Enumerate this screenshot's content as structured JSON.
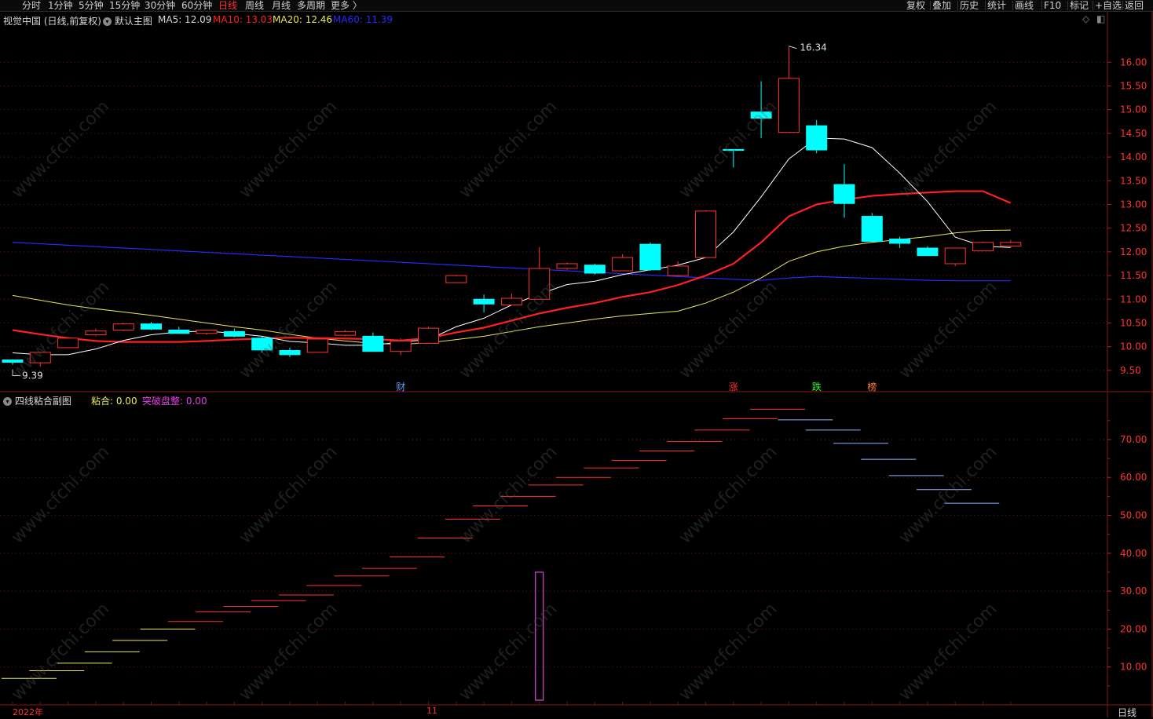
{
  "periods": [
    "分时",
    "1分钟",
    "5分钟",
    "15分钟",
    "30分钟",
    "60分钟",
    "日线",
    "周线",
    "月线",
    "多周期",
    "更多 〉"
  ],
  "active_period": "日线",
  "right_tools": [
    "复权",
    "叠加",
    "历史",
    "统计",
    "画线",
    "F10",
    "标记",
    "+自选",
    "返回"
  ],
  "main": {
    "stock_label": "视觉中国 (日线,前复权)",
    "template_label": "默认主图",
    "ma5": "MA5: 12.09",
    "ma10": "MA10: 13.03",
    "ma20": "MA20: 12.46",
    "ma60": "MA60: 11.39",
    "high_label": "16.34",
    "low_label": "9.39",
    "y_ticks": [
      "16.00",
      "15.50",
      "15.00",
      "14.50",
      "14.00",
      "13.50",
      "13.00",
      "12.50",
      "12.00",
      "11.50",
      "11.00",
      "10.50",
      "10.00",
      "9.50"
    ],
    "markers": [
      "财",
      "涨",
      "跌",
      "榜"
    ]
  },
  "sub": {
    "title": "四线粘合副图",
    "nianhe": "粘合: 0.00",
    "tupo": "突破盘整: 0.00",
    "y_ticks": [
      "70.00",
      "60.00",
      "50.00",
      "40.00",
      "30.00",
      "20.00",
      "10.00"
    ]
  },
  "bottom": {
    "year_label": "2022年",
    "month_label": "11",
    "period_label": "日线"
  },
  "watermark": "www.cfchi.com",
  "colors": {
    "up": "#ff3232",
    "down": "#00ffff",
    "ma5": "#ffffff",
    "ma10": "#ff2020",
    "ma20": "#e8e85a",
    "ma60": "#2828ff",
    "grid": "#7a1010",
    "sub_violet": "#e040e0"
  },
  "chart_data": {
    "type": "candlestick",
    "candles": [
      [
        9.72,
        9.72,
        9.62,
        9.67
      ],
      [
        9.66,
        9.88,
        9.58,
        9.88
      ],
      [
        9.98,
        10.2,
        9.98,
        10.18
      ],
      [
        10.25,
        10.38,
        10.22,
        10.33
      ],
      [
        10.35,
        10.5,
        10.33,
        10.48
      ],
      [
        10.48,
        10.52,
        10.35,
        10.37
      ],
      [
        10.35,
        10.42,
        10.28,
        10.28
      ],
      [
        10.28,
        10.35,
        10.25,
        10.35
      ],
      [
        10.32,
        10.38,
        10.2,
        10.22
      ],
      [
        10.18,
        10.22,
        9.88,
        9.93
      ],
      [
        9.92,
        9.98,
        9.78,
        9.83
      ],
      [
        9.88,
        10.18,
        9.88,
        10.16
      ],
      [
        10.24,
        10.35,
        10.22,
        10.32
      ],
      [
        10.22,
        10.3,
        9.9,
        9.9
      ],
      [
        9.9,
        10.18,
        9.82,
        10.12
      ],
      [
        10.07,
        10.42,
        10.07,
        10.39
      ],
      [
        11.35,
        11.52,
        11.35,
        11.5
      ],
      [
        11.0,
        11.1,
        10.72,
        10.9
      ],
      [
        10.88,
        11.12,
        10.88,
        11.02
      ],
      [
        11.0,
        12.1,
        11.0,
        11.65
      ],
      [
        11.65,
        11.78,
        11.62,
        11.75
      ],
      [
        11.72,
        11.75,
        11.52,
        11.55
      ],
      [
        11.6,
        11.95,
        11.6,
        11.88
      ],
      [
        12.16,
        12.2,
        11.6,
        11.62
      ],
      [
        11.5,
        11.8,
        11.48,
        11.7
      ],
      [
        11.88,
        12.88,
        11.88,
        12.86
      ],
      [
        14.16,
        14.16,
        13.78,
        14.14
      ],
      [
        14.95,
        15.6,
        14.4,
        14.82
      ],
      [
        14.52,
        16.34,
        14.52,
        15.66
      ],
      [
        14.66,
        14.78,
        14.08,
        14.15
      ],
      [
        13.42,
        13.85,
        12.72,
        13.02
      ],
      [
        12.75,
        12.82,
        12.2,
        12.22
      ],
      [
        12.27,
        12.32,
        12.08,
        12.18
      ],
      [
        12.08,
        12.12,
        11.92,
        11.92
      ],
      [
        11.75,
        12.05,
        11.7,
        12.08
      ],
      [
        12.02,
        12.22,
        12.02,
        12.2
      ],
      [
        12.12,
        12.25,
        12.08,
        12.2
      ]
    ],
    "ma5": [
      9.87,
      9.83,
      9.83,
      9.95,
      10.13,
      10.25,
      10.31,
      10.33,
      10.28,
      10.22,
      10.11,
      10.08,
      10.03,
      10.03,
      10.1,
      10.15,
      10.42,
      10.6,
      10.88,
      11.11,
      11.31,
      11.38,
      11.52,
      11.62,
      11.72,
      11.88,
      12.42,
      13.16,
      13.96,
      14.4,
      14.38,
      14.2,
      13.66,
      13.06,
      12.31,
      12.12,
      12.09
    ],
    "ma10": [
      10.35,
      10.26,
      10.18,
      10.12,
      10.1,
      10.1,
      10.1,
      10.12,
      10.15,
      10.17,
      10.19,
      10.18,
      10.17,
      10.16,
      10.13,
      10.18,
      10.3,
      10.4,
      10.55,
      10.7,
      10.82,
      10.92,
      11.05,
      11.15,
      11.3,
      11.5,
      11.75,
      12.2,
      12.75,
      13.0,
      13.1,
      13.18,
      13.22,
      13.25,
      13.28,
      13.28,
      13.03
    ],
    "ma20": [
      11.08,
      10.98,
      10.88,
      10.8,
      10.73,
      10.66,
      10.58,
      10.5,
      10.42,
      10.35,
      10.26,
      10.18,
      10.12,
      10.07,
      10.05,
      10.08,
      10.15,
      10.22,
      10.32,
      10.42,
      10.5,
      10.58,
      10.65,
      10.7,
      10.75,
      10.92,
      11.15,
      11.45,
      11.8,
      12.0,
      12.12,
      12.2,
      12.26,
      12.32,
      12.4,
      12.45,
      12.46
    ],
    "ma60": [
      12.2,
      12.17,
      12.14,
      12.11,
      12.08,
      12.05,
      12.02,
      11.99,
      11.96,
      11.93,
      11.9,
      11.87,
      11.84,
      11.81,
      11.78,
      11.75,
      11.72,
      11.69,
      11.66,
      11.63,
      11.6,
      11.57,
      11.54,
      11.51,
      11.48,
      11.45,
      11.42,
      11.4,
      11.45,
      11.48,
      11.46,
      11.44,
      11.42,
      11.4,
      11.39,
      11.39,
      11.39
    ],
    "ylim": [
      9.1,
      16.7
    ],
    "sub_lines": [
      [
        7,
        "#e8e85a"
      ],
      [
        9,
        "#e8e85a"
      ],
      [
        11,
        "#e8e85a"
      ],
      [
        14,
        "#e8e85a"
      ],
      [
        17,
        "#e8e85a"
      ],
      [
        20,
        "#e8e85a"
      ],
      [
        22,
        "#ff3232"
      ],
      [
        24.5,
        "#ff3232"
      ],
      [
        26,
        "#ff3232"
      ],
      [
        27.5,
        "#ff3232"
      ],
      [
        29,
        "#ff3232"
      ],
      [
        31.5,
        "#ff3232"
      ],
      [
        34,
        "#ff3232"
      ],
      [
        36,
        "#ff3232"
      ],
      [
        39,
        "#ff3232"
      ],
      [
        44,
        "#ff3232"
      ],
      [
        49,
        "#ff3232"
      ],
      [
        52.5,
        "#ff3232"
      ],
      [
        55,
        "#ff3232"
      ],
      [
        58,
        "#ff3232"
      ],
      [
        60,
        "#ff3232"
      ],
      [
        62.5,
        "#ff3232"
      ],
      [
        64.5,
        "#ff3232"
      ],
      [
        67,
        "#ff3232"
      ],
      [
        69.5,
        "#ff3232"
      ],
      [
        72.5,
        "#ff3232"
      ],
      [
        75.5,
        "#ff3232"
      ],
      [
        78,
        "#ff3232"
      ],
      [
        75.2,
        "#8ab8ff"
      ],
      [
        72.5,
        "#8ab8ff"
      ],
      [
        69,
        "#8ab8ff"
      ],
      [
        64.8,
        "#8ab8ff"
      ],
      [
        60.5,
        "#8ab8ff"
      ],
      [
        56.8,
        "#8ab8ff"
      ],
      [
        53.2,
        "#8ab8ff"
      ]
    ],
    "sub_bar": {
      "index": 19,
      "value": 35
    },
    "sub_ylim": [
      0,
      82
    ]
  }
}
